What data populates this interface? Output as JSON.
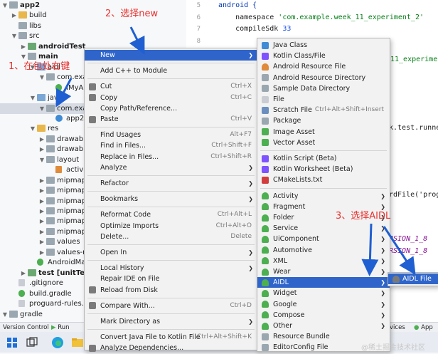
{
  "tree": {
    "rows": [
      {
        "label": "app2",
        "indent": 0,
        "arrow": "v",
        "icon": "folder-icon",
        "bold": true
      },
      {
        "label": "build",
        "indent": 1,
        "arrow": ">",
        "icon": "folder-icon-yellow"
      },
      {
        "label": "libs",
        "indent": 1,
        "arrow": "",
        "icon": "folder-icon"
      },
      {
        "label": "src",
        "indent": 1,
        "arrow": "v",
        "icon": "folder-icon"
      },
      {
        "label": "androidTest",
        "indent": 2,
        "arrow": ">",
        "icon": "folder-icon-green",
        "bold": true
      },
      {
        "label": "main",
        "indent": 2,
        "arrow": "v",
        "icon": "folder-icon",
        "bold": true
      },
      {
        "label": "aidl",
        "indent": 3,
        "arrow": "v",
        "icon": "folder-icon-src"
      },
      {
        "label": "com.exam",
        "indent": 4,
        "arrow": "v",
        "icon": "package-icon"
      },
      {
        "label": "IMyAid",
        "indent": 5,
        "arrow": "",
        "icon": "aidl-file-icon"
      },
      {
        "label": "java",
        "indent": 3,
        "arrow": "v",
        "icon": "folder-icon-src"
      },
      {
        "label": "com.exam",
        "indent": 4,
        "arrow": "v",
        "icon": "package-icon",
        "selected": true
      },
      {
        "label": "app2",
        "indent": 5,
        "arrow": "",
        "icon": "class-icon"
      },
      {
        "label": "res",
        "indent": 3,
        "arrow": "v",
        "icon": "folder-icon-yellow"
      },
      {
        "label": "drawable",
        "indent": 4,
        "arrow": ">",
        "icon": "folder-icon"
      },
      {
        "label": "drawable",
        "indent": 4,
        "arrow": ">",
        "icon": "folder-icon"
      },
      {
        "label": "layout",
        "indent": 4,
        "arrow": "v",
        "icon": "folder-icon"
      },
      {
        "label": "activit",
        "indent": 5,
        "arrow": "",
        "icon": "xml-file-icon"
      },
      {
        "label": "mipmap-",
        "indent": 4,
        "arrow": ">",
        "icon": "folder-icon"
      },
      {
        "label": "mipmap-",
        "indent": 4,
        "arrow": ">",
        "icon": "folder-icon"
      },
      {
        "label": "mipmap-",
        "indent": 4,
        "arrow": ">",
        "icon": "folder-icon"
      },
      {
        "label": "mipmap-",
        "indent": 4,
        "arrow": ">",
        "icon": "folder-icon"
      },
      {
        "label": "mipmap-",
        "indent": 4,
        "arrow": ">",
        "icon": "folder-icon"
      },
      {
        "label": "mipmap-",
        "indent": 4,
        "arrow": ">",
        "icon": "folder-icon"
      },
      {
        "label": "values",
        "indent": 4,
        "arrow": ">",
        "icon": "folder-icon"
      },
      {
        "label": "values-ni",
        "indent": 4,
        "arrow": ">",
        "icon": "folder-icon"
      },
      {
        "label": "AndroidMan",
        "indent": 3,
        "arrow": "",
        "icon": "manifest-icon"
      },
      {
        "label": "test [unitTest]",
        "indent": 2,
        "arrow": ">",
        "icon": "folder-icon-green",
        "bold": true
      },
      {
        "label": ".gitignore",
        "indent": 1,
        "arrow": "",
        "icon": "file-icon"
      },
      {
        "label": "build.gradle",
        "indent": 1,
        "arrow": "",
        "icon": "gradle-icon"
      },
      {
        "label": "proguard-rules.pro",
        "indent": 1,
        "arrow": "",
        "icon": "file-icon"
      },
      {
        "label": "gradle",
        "indent": 0,
        "arrow": "v",
        "icon": "folder-icon"
      }
    ]
  },
  "editor": {
    "lines": [
      {
        "num": "",
        "parts": [
          {
            "t": "android {",
            "c": "kw"
          }
        ]
      },
      {
        "num": "",
        "parts": [
          {
            "t": "    namespace ",
            "c": ""
          },
          {
            "t": "'com.example.week_11_experiment_2'",
            "c": "str"
          }
        ]
      },
      {
        "num": "",
        "parts": [
          {
            "t": "    compileSdk ",
            "c": ""
          },
          {
            "t": "33",
            "c": "num"
          }
        ]
      }
    ],
    "gutter_nums": [
      "5",
      "6",
      "7",
      "8",
      "9"
    ],
    "fragments": [
      {
        "text": "11_experime",
        "cls": "str"
      },
      {
        "text": "k.test.runne",
        "cls": ""
      },
      {
        "text": "rdFile('prog",
        "cls": ""
      },
      {
        "text": "RSION_1_8",
        "cls": "ital"
      },
      {
        "text": "RSION_1_8",
        "cls": "ital"
      }
    ]
  },
  "context_menu": {
    "items": [
      {
        "label": "New",
        "shortcut": "",
        "submenu": true,
        "highlight": true,
        "icon": ""
      },
      {
        "sep": true
      },
      {
        "label": "Add C++ to Module",
        "shortcut": "",
        "icon": ""
      },
      {
        "sep": true
      },
      {
        "label": "Cut",
        "shortcut": "Ctrl+X",
        "icon": "cut-icon"
      },
      {
        "label": "Copy",
        "shortcut": "Ctrl+C",
        "icon": "copy-icon"
      },
      {
        "label": "Copy Path/Reference...",
        "shortcut": "",
        "icon": ""
      },
      {
        "label": "Paste",
        "shortcut": "Ctrl+V",
        "icon": "paste-icon"
      },
      {
        "sep": true
      },
      {
        "label": "Find Usages",
        "shortcut": "Alt+F7",
        "icon": ""
      },
      {
        "label": "Find in Files...",
        "shortcut": "Ctrl+Shift+F",
        "icon": ""
      },
      {
        "label": "Replace in Files...",
        "shortcut": "Ctrl+Shift+R",
        "icon": ""
      },
      {
        "label": "Analyze",
        "shortcut": "",
        "submenu": true,
        "icon": ""
      },
      {
        "sep": true
      },
      {
        "label": "Refactor",
        "shortcut": "",
        "submenu": true,
        "icon": ""
      },
      {
        "sep": true
      },
      {
        "label": "Bookmarks",
        "shortcut": "",
        "submenu": true,
        "icon": ""
      },
      {
        "sep": true
      },
      {
        "label": "Reformat Code",
        "shortcut": "Ctrl+Alt+L",
        "icon": ""
      },
      {
        "label": "Optimize Imports",
        "shortcut": "Ctrl+Alt+O",
        "icon": ""
      },
      {
        "label": "Delete...",
        "shortcut": "Delete",
        "icon": ""
      },
      {
        "sep": true
      },
      {
        "label": "Open In",
        "shortcut": "",
        "submenu": true,
        "icon": ""
      },
      {
        "sep": true
      },
      {
        "label": "Local History",
        "shortcut": "",
        "submenu": true,
        "icon": ""
      },
      {
        "label": "Repair IDE on File",
        "shortcut": "",
        "icon": ""
      },
      {
        "label": "Reload from Disk",
        "shortcut": "",
        "icon": "reload-icon"
      },
      {
        "sep": true
      },
      {
        "label": "Compare With...",
        "shortcut": "Ctrl+D",
        "icon": "compare-icon"
      },
      {
        "sep": true
      },
      {
        "label": "Mark Directory as",
        "shortcut": "",
        "submenu": true,
        "icon": ""
      },
      {
        "sep": true
      },
      {
        "label": "Convert Java File to Kotlin File",
        "shortcut": "Ctrl+Alt+Shift+K",
        "icon": ""
      },
      {
        "label": "Analyze Dependencies...",
        "shortcut": "",
        "icon": "analyze-icon"
      }
    ]
  },
  "new_menu": {
    "items": [
      {
        "label": "Java Class",
        "shortcut": "",
        "icon": "java-class-icon",
        "color": "#3f8bd6"
      },
      {
        "label": "Kotlin Class/File",
        "shortcut": "",
        "icon": "kotlin-icon",
        "color": "#7f52ff"
      },
      {
        "label": "Android Resource File",
        "shortcut": "",
        "icon": "android-resource-file-icon",
        "color": "#e08a3b"
      },
      {
        "label": "Android Resource Directory",
        "shortcut": "",
        "icon": "folder-icon",
        "color": "#9aa7b0"
      },
      {
        "label": "Sample Data Directory",
        "shortcut": "",
        "icon": "folder-icon",
        "color": "#9aa7b0"
      },
      {
        "label": "File",
        "shortcut": "",
        "icon": "file-icon",
        "color": "#c9ccd3"
      },
      {
        "label": "Scratch File",
        "shortcut": "Ctrl+Alt+Shift+Insert",
        "icon": "scratch-file-icon",
        "color": "#6a8fbf"
      },
      {
        "label": "Package",
        "shortcut": "",
        "icon": "package-icon",
        "color": "#9aa7b0"
      },
      {
        "label": "Image Asset",
        "shortcut": "",
        "icon": "image-asset-icon",
        "color": "#4caf50"
      },
      {
        "label": "Vector Asset",
        "shortcut": "",
        "icon": "vector-asset-icon",
        "color": "#4caf50"
      },
      {
        "sep": true
      },
      {
        "label": "Kotlin Script (Beta)",
        "shortcut": "",
        "icon": "kotlin-script-icon",
        "color": "#7f52ff"
      },
      {
        "label": "Kotlin Worksheet (Beta)",
        "shortcut": "",
        "icon": "kotlin-worksheet-icon",
        "color": "#7f52ff"
      },
      {
        "label": "CMakeLists.txt",
        "shortcut": "",
        "icon": "cmake-icon",
        "color": "#d33c3c"
      },
      {
        "sep": true
      },
      {
        "label": "Activity",
        "shortcut": "",
        "submenu": true,
        "icon": "android-icon",
        "color": "#4caf50"
      },
      {
        "label": "Fragment",
        "shortcut": "",
        "submenu": true,
        "icon": "android-icon",
        "color": "#4caf50"
      },
      {
        "label": "Folder",
        "shortcut": "",
        "submenu": true,
        "icon": "android-icon",
        "color": "#4caf50"
      },
      {
        "label": "Service",
        "shortcut": "",
        "submenu": true,
        "icon": "android-icon",
        "color": "#4caf50"
      },
      {
        "label": "UiComponent",
        "shortcut": "",
        "submenu": true,
        "icon": "android-icon",
        "color": "#4caf50"
      },
      {
        "label": "Automotive",
        "shortcut": "",
        "submenu": true,
        "icon": "android-icon",
        "color": "#4caf50"
      },
      {
        "label": "XML",
        "shortcut": "",
        "submenu": true,
        "icon": "android-icon",
        "color": "#4caf50"
      },
      {
        "label": "Wear",
        "shortcut": "",
        "submenu": true,
        "icon": "android-icon",
        "color": "#4caf50"
      },
      {
        "label": "AIDL",
        "shortcut": "",
        "submenu": true,
        "highlight": true,
        "icon": "android-icon",
        "color": "#4caf50"
      },
      {
        "label": "Widget",
        "shortcut": "",
        "submenu": true,
        "icon": "android-icon",
        "color": "#4caf50"
      },
      {
        "label": "Google",
        "shortcut": "",
        "submenu": true,
        "icon": "android-icon",
        "color": "#4caf50"
      },
      {
        "label": "Compose",
        "shortcut": "",
        "submenu": true,
        "icon": "android-icon",
        "color": "#4caf50"
      },
      {
        "label": "Other",
        "shortcut": "",
        "submenu": true,
        "icon": "android-icon",
        "color": "#4caf50"
      },
      {
        "label": "Resource Bundle",
        "shortcut": "",
        "icon": "resource-bundle-icon",
        "color": "#9aa7b0"
      },
      {
        "label": "EditorConfig File",
        "shortcut": "",
        "icon": "editorconfig-icon",
        "color": "#9aa7b0"
      }
    ]
  },
  "aidl_menu": {
    "items": [
      {
        "label": "AIDL File",
        "icon": "android-icon",
        "highlight": true
      }
    ]
  },
  "annotations": {
    "step1": "1、在包处右键",
    "step2": "2、选择new",
    "step3": "3、选择AIDL"
  },
  "toolbar": {
    "version_control": "Version Control",
    "run": "Run",
    "services": "vices",
    "app_inspection": "App In"
  },
  "watermark": "@稀土掘金技术社区",
  "colors": {
    "menu_highlight": "#2f65ca",
    "annotation_red": "#e8322e",
    "arrow_blue": "#1f5fd1"
  }
}
